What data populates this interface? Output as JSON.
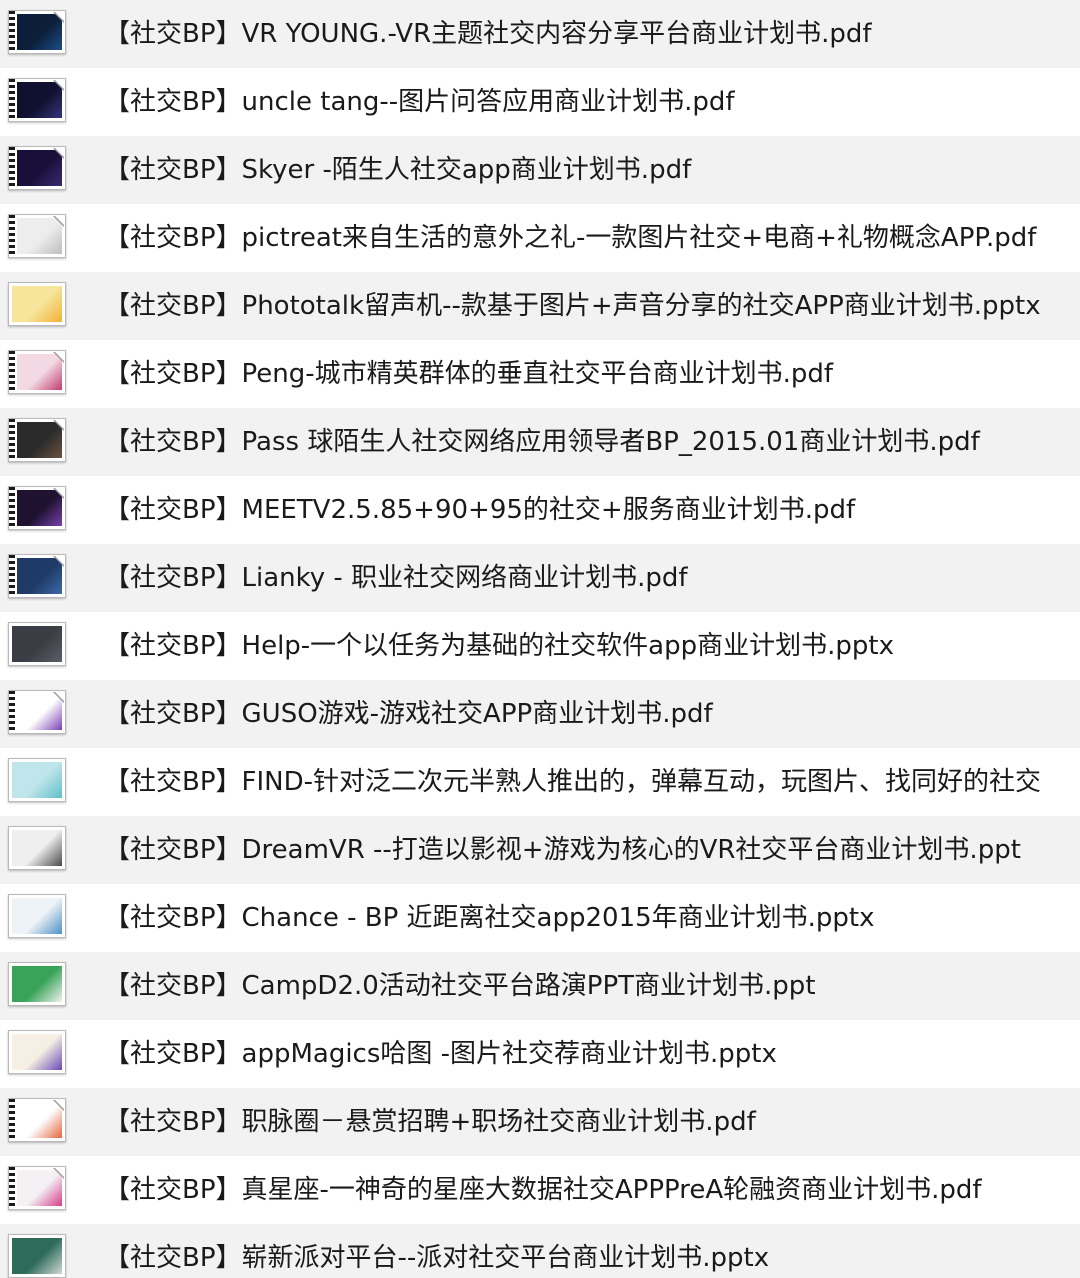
{
  "file_list": {
    "items": [
      {
        "name": "【社交BP】VR YOUNG.-VR主题社交内容分享平台商业计划书.pdf",
        "thumb_kind": "pdf",
        "thumb_colors": [
          "#0b1e3a",
          "#1d4f8a"
        ]
      },
      {
        "name": "【社交BP】uncle tang--图片问答应用商业计划书.pdf",
        "thumb_kind": "pdf",
        "thumb_colors": [
          "#101030",
          "#35357a"
        ]
      },
      {
        "name": "【社交BP】Skyer -陌生人社交app商业计划书.pdf",
        "thumb_kind": "pdf",
        "thumb_colors": [
          "#1a0f3a",
          "#3a2a72"
        ]
      },
      {
        "name": "【社交BP】pictreat来自生活的意外之礼-一款图片社交+电商+礼物概念APP.pdf",
        "thumb_kind": "pdf",
        "thumb_colors": [
          "#ededed",
          "#bdbdbd"
        ]
      },
      {
        "name": "【社交BP】Phototalk留声机--款基于图片+声音分享的社交APP商业计划书.pptx",
        "thumb_kind": "pptx",
        "thumb_colors": [
          "#f6e59a",
          "#f2b233"
        ]
      },
      {
        "name": "【社交BP】Peng-城市精英群体的垂直社交平台商业计划书.pdf",
        "thumb_kind": "pdf",
        "thumb_colors": [
          "#f3d9e3",
          "#c23a6b"
        ]
      },
      {
        "name": "【社交BP】Pass 球陌生人社交网络应用领导者BP_2015.01商业计划书.pdf",
        "thumb_kind": "pdf",
        "thumb_colors": [
          "#2a2a2a",
          "#6b5340"
        ]
      },
      {
        "name": "【社交BP】MEETV2.5.85+90+95的社交+服务商业计划书.pdf",
        "thumb_kind": "pdf",
        "thumb_colors": [
          "#1e1230",
          "#7a3fb0"
        ]
      },
      {
        "name": "【社交BP】Lianky - 职业社交网络商业计划书.pdf",
        "thumb_kind": "pdf",
        "thumb_colors": [
          "#1e3a66",
          "#3d6aa8"
        ]
      },
      {
        "name": "【社交BP】Help-一个以任务为基础的社交软件app商业计划书.pptx",
        "thumb_kind": "pptx",
        "thumb_colors": [
          "#3a3d44",
          "#5a5e66"
        ]
      },
      {
        "name": "【社交BP】GUSO游戏-游戏社交APP商业计划书.pdf",
        "thumb_kind": "pdf",
        "thumb_colors": [
          "#ffffff",
          "#7b3fb8"
        ]
      },
      {
        "name": "【社交BP】FIND-针对泛二次元半熟人推出的，弹幕互动，玩图片、找同好的社交",
        "thumb_kind": "pptx",
        "thumb_colors": [
          "#bfe6ea",
          "#5fbec8"
        ]
      },
      {
        "name": "【社交BP】DreamVR --打造以影视+游戏为核心的VR社交平台商业计划书.ppt",
        "thumb_kind": "pptx",
        "thumb_colors": [
          "#efefef",
          "#4a4a4a"
        ]
      },
      {
        "name": "【社交BP】Chance - BP 近距离社交app2015年商业计划书.pptx",
        "thumb_kind": "pptx",
        "thumb_colors": [
          "#eef3f7",
          "#4a90c8"
        ]
      },
      {
        "name": "【社交BP】CampD2.0活动社交平台路演PPT商业计划书.ppt",
        "thumb_kind": "pptx",
        "thumb_colors": [
          "#3aa35a",
          "#f2f2f2"
        ]
      },
      {
        "name": "【社交BP】appMagics哈图 -图片社交荐商业计划书.pptx",
        "thumb_kind": "pptx",
        "thumb_colors": [
          "#f6f0e4",
          "#6a48b8"
        ]
      },
      {
        "name": "【社交BP】职脉圈－悬赏招聘+职场社交商业计划书.pdf",
        "thumb_kind": "pdf",
        "thumb_colors": [
          "#ffffff",
          "#e8643a"
        ]
      },
      {
        "name": "【社交BP】真星座-一神奇的星座大数据社交APPPreA轮融资商业计划书.pdf",
        "thumb_kind": "pdf",
        "thumb_colors": [
          "#f4f0f4",
          "#d83a8a"
        ]
      },
      {
        "name": "【社交BP】崭新派对平台--派对社交平台商业计划书.pptx",
        "thumb_kind": "pptx",
        "thumb_colors": [
          "#2f6b5a",
          "#d0d8d4"
        ]
      }
    ]
  }
}
